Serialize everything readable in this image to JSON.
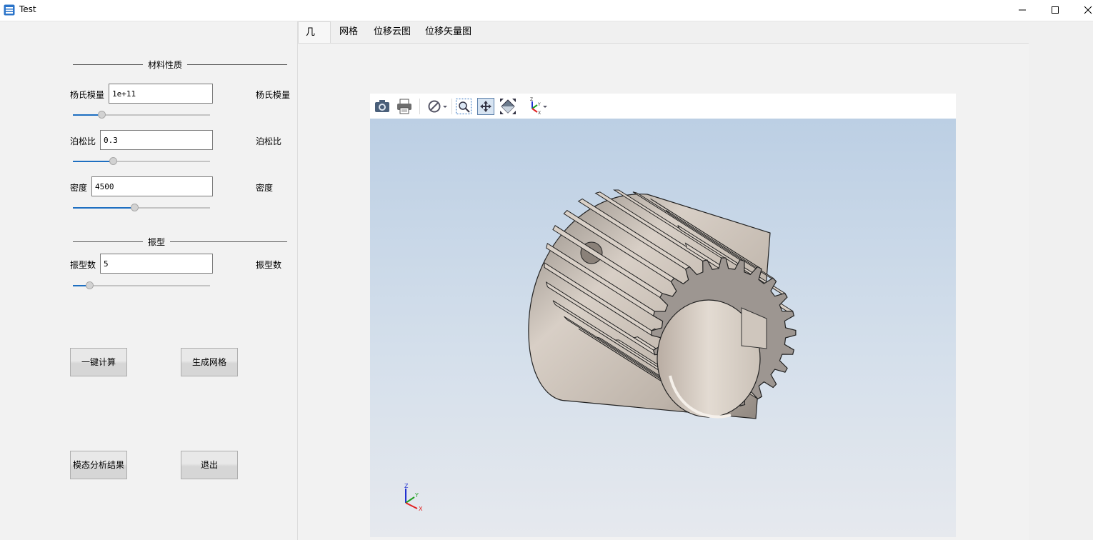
{
  "window": {
    "title": "Test"
  },
  "material": {
    "group_title": "材料性质",
    "youngs": {
      "label": "杨氏模量",
      "value": "1e+11",
      "unit_label": "杨氏模量",
      "slider_fraction": 0.21
    },
    "poisson": {
      "label": "泊松比",
      "value": "0.3",
      "unit_label": "泊松比",
      "slider_fraction": 0.29
    },
    "density": {
      "label": "密度",
      "value": "4500",
      "unit_label": "密度",
      "slider_fraction": 0.45
    }
  },
  "mode": {
    "group_title": "振型",
    "count": {
      "label": "振型数",
      "value": "5",
      "unit_label": "振型数",
      "slider_fraction": 0.12
    }
  },
  "buttons": {
    "compute": "一键计算",
    "mesh": "生成网格",
    "modal_result": "模态分析结果",
    "exit": "退出"
  },
  "tabs": [
    "几何",
    "网格",
    "位移云图",
    "位移矢量图"
  ],
  "viewer": {
    "toolbar_icons": [
      "camera-icon",
      "print-icon",
      "clip-plane-icon",
      "zoom-window-icon",
      "pan-icon",
      "fit-all-icon",
      "view-orientation-icon"
    ],
    "axis_labels": {
      "x": "X",
      "y": "Y",
      "z": "Z"
    }
  },
  "colors": {
    "accent": "#1e6fc1",
    "gear_face": "#9d9691",
    "gear_side": "#cfc6bd",
    "axis_x": "#e02020",
    "axis_y": "#20a020",
    "axis_z": "#2030d0"
  }
}
